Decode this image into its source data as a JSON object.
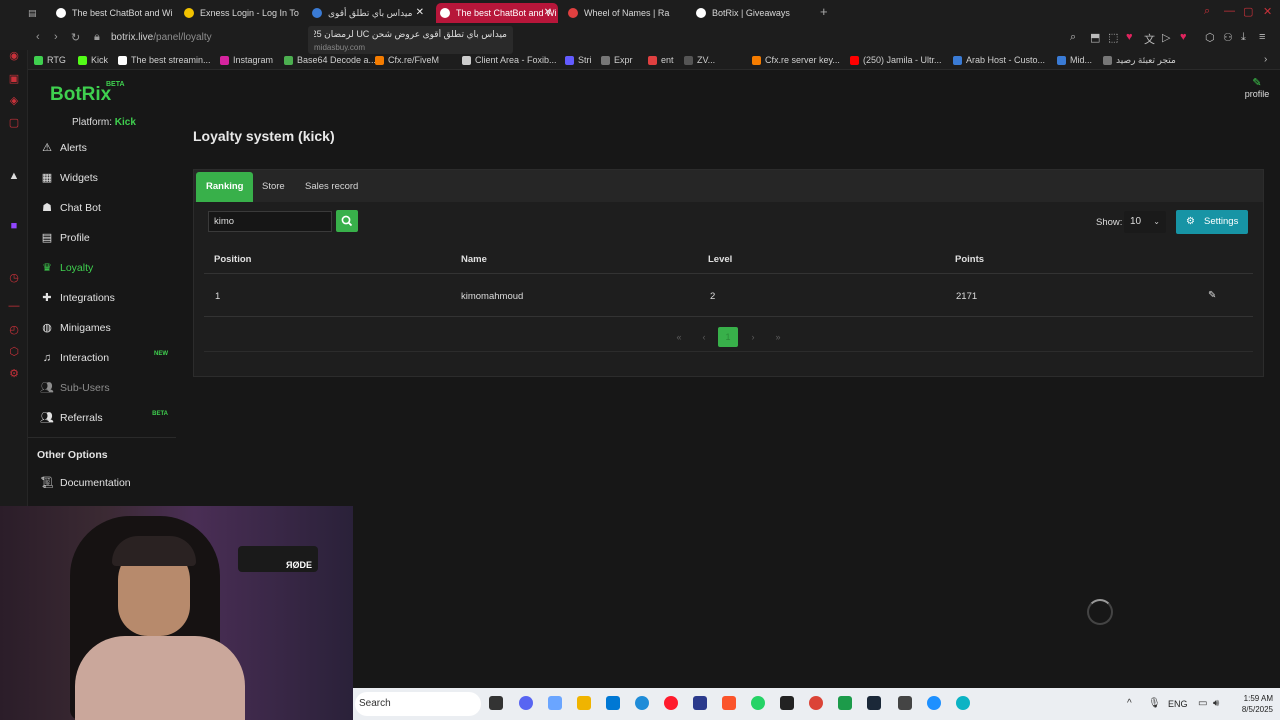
{
  "browser": {
    "tabs": [
      {
        "title": "The best ChatBot and Wi",
        "active": false,
        "favicon": "#ffffff"
      },
      {
        "title": "Exness Login - Log In To",
        "active": false,
        "favicon": "#f2c200"
      },
      {
        "title": "ميداس باي تطلق أقوى",
        "active": false,
        "favicon": "#3a7bd5"
      },
      {
        "title": "The best ChatBot and Wi",
        "active": true,
        "favicon": "#ffffff"
      },
      {
        "title": "Wheel of Names | Ra",
        "active": false,
        "favicon": "#e04040"
      },
      {
        "title": "BotRix | Giveaways",
        "active": false,
        "favicon": "#ffffff"
      }
    ],
    "tooltip": {
      "title": "ميداس باي تطلق أقوى عروض شحن UC لرمضان 2025 | ...",
      "url": "midasbuy.com"
    },
    "url_domain": "botrix.live",
    "url_path": "/panel/loyalty",
    "bookmarks": [
      {
        "label": "RTG",
        "color": "#3fd04f"
      },
      {
        "label": "Kick",
        "color": "#53fc18"
      },
      {
        "label": "The best streamin...",
        "color": "#ffffff"
      },
      {
        "label": "Instagram",
        "color": "#d6249f"
      },
      {
        "label": "Base64 Decode a...",
        "color": "#4caf50"
      },
      {
        "label": "Cfx.re/FiveM",
        "color": "#f57c00"
      },
      {
        "label": "Client Area - Foxib...",
        "color": "#cccccc"
      },
      {
        "label": "Stri",
        "color": "#635bff"
      },
      {
        "label": "Expr",
        "color": "#777777"
      },
      {
        "label": "ent",
        "color": "#e04040"
      },
      {
        "label": "ZV...",
        "color": "#555555"
      },
      {
        "label": "Cfx.re server key...",
        "color": "#f57c00"
      },
      {
        "label": "(250) Jamila - Ultr...",
        "color": "#ff0000"
      },
      {
        "label": "Arab Host - Custo...",
        "color": "#3a7bd5"
      },
      {
        "label": "Mid...",
        "color": "#3a7bd5"
      },
      {
        "label": "متجر تعبئة رصيد",
        "color": "#777777"
      }
    ]
  },
  "app": {
    "brand": "BotRix",
    "brand_badge": "BETA",
    "platform_label": "Platform:",
    "platform_value": "Kick",
    "profile_label": "profile",
    "accent": "#3fd04f",
    "sidebar": [
      {
        "label": "Alerts",
        "icon": "warning-icon",
        "state": "normal",
        "badge": ""
      },
      {
        "label": "Widgets",
        "icon": "widgets-icon",
        "state": "normal",
        "badge": ""
      },
      {
        "label": "Chat Bot",
        "icon": "robot-icon",
        "state": "normal",
        "badge": ""
      },
      {
        "label": "Profile",
        "icon": "id-card-icon",
        "state": "normal",
        "badge": ""
      },
      {
        "label": "Loyalty",
        "icon": "trophy-icon",
        "state": "active",
        "badge": ""
      },
      {
        "label": "Integrations",
        "icon": "puzzle-icon",
        "state": "normal",
        "badge": ""
      },
      {
        "label": "Minigames",
        "icon": "gamepad-icon",
        "state": "normal",
        "badge": ""
      },
      {
        "label": "Interaction",
        "icon": "music-icon",
        "state": "normal",
        "badge": "NEW"
      },
      {
        "label": "Sub-Users",
        "icon": "users-icon",
        "state": "disabled",
        "badge": ""
      },
      {
        "label": "Referrals",
        "icon": "users-icon",
        "state": "normal",
        "badge": "BETA"
      }
    ],
    "other_options_label": "Other Options",
    "documentation_label": "Documentation"
  },
  "main": {
    "title": "Loyalty system (kick)",
    "tabs": [
      "Ranking",
      "Store",
      "Sales record"
    ],
    "active_tab": "Ranking",
    "search_value": "kimo",
    "show_label": "Show:",
    "show_value": "10",
    "settings_label": "Settings",
    "columns": [
      "Position",
      "Name",
      "Level",
      "Points"
    ],
    "rows": [
      {
        "position": "1",
        "name": "kimomahmoud",
        "level": "2",
        "points": "2171"
      }
    ],
    "pagination": {
      "current": "1"
    }
  },
  "taskbar": {
    "search_placeholder": "Search",
    "language": "ENG",
    "time": "1:59 AM",
    "date": "8/5/2025"
  }
}
